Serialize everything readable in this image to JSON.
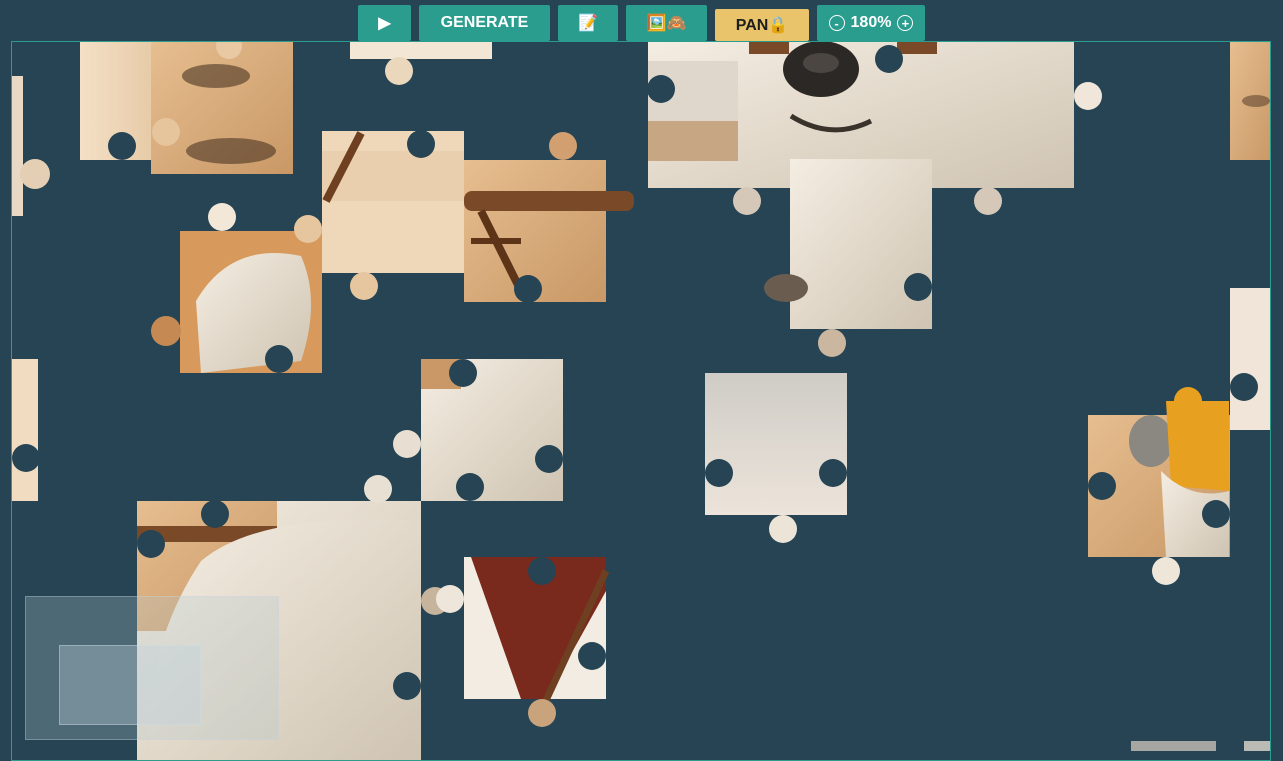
{
  "toolbar": {
    "play_label": "▶",
    "generate_label": "GENERATE",
    "notes_label": "📝",
    "preview_toggle_label": "🖼️🙈",
    "pan_label": "PAN🔒",
    "zoom_out_label": "-",
    "zoom_level": "180%",
    "zoom_in_label": "+"
  },
  "colors": {
    "background": "#264453",
    "button": "#2a9d8f",
    "pan_button": "#e9c46a",
    "sand": "#d8a878",
    "fur": "#ece4d8",
    "wood": "#7a4a28",
    "beer": "#e8a020",
    "sky": "#d8d4cc"
  },
  "board": {
    "piece_count_visible": 17,
    "pieces": [
      {
        "id": "sand-topleft",
        "content": "sand"
      },
      {
        "id": "sand-edge-left",
        "content": "sand"
      },
      {
        "id": "sand-top-mid",
        "content": "sand"
      },
      {
        "id": "bear-paw-left",
        "content": "fur"
      },
      {
        "id": "chair-top",
        "content": "chair"
      },
      {
        "id": "chair-arm",
        "content": "chair"
      },
      {
        "id": "bear-face",
        "content": "bear"
      },
      {
        "id": "bear-chest",
        "content": "fur"
      },
      {
        "id": "sand-right-edge",
        "content": "sand"
      },
      {
        "id": "sky-right-edge",
        "content": "sky"
      },
      {
        "id": "fur-mid",
        "content": "fur"
      },
      {
        "id": "sky-center",
        "content": "sky"
      },
      {
        "id": "sand-left-edge-2",
        "content": "sand"
      },
      {
        "id": "beer-glass",
        "content": "beer"
      },
      {
        "id": "bear-body",
        "content": "fur"
      },
      {
        "id": "chair-canvas",
        "content": "chair"
      },
      {
        "id": "bottom-right-bits",
        "content": "sand"
      }
    ]
  }
}
